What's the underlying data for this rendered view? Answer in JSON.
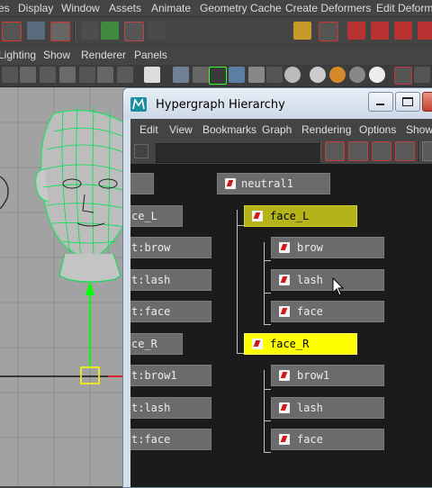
{
  "menubar": {
    "items": [
      "es",
      "Display",
      "Window",
      "Assets",
      "Animate",
      "Geometry Cache",
      "Create Deformers",
      "Edit Deforme"
    ]
  },
  "panel_menu": {
    "items": [
      "Lighting",
      "Show",
      "Renderer",
      "Panels"
    ]
  },
  "hypergraph": {
    "title": "Hypergraph Hierarchy",
    "menu": [
      "Edit",
      "View",
      "Bookmarks",
      "Graph",
      "Rendering",
      "Options",
      "Show"
    ],
    "search_value": "",
    "nodes_right": {
      "root": "neutral1",
      "group_a": "face_L",
      "group_a_children": [
        "brow",
        "lash",
        "face"
      ],
      "group_b": "face_R",
      "group_b_children": [
        "brow1",
        "lash",
        "face"
      ]
    },
    "nodes_left": [
      "",
      "ce_L",
      "t:brow",
      "t:lash",
      "t:face",
      "ce_R",
      "t:brow1",
      "t:lash",
      "t:face"
    ]
  },
  "colors": {
    "selected_node": "#b4b41a",
    "highlight_node": "#ffff00",
    "wireframe": "#00ff66",
    "viewport_bg": "#a2a2a2"
  }
}
